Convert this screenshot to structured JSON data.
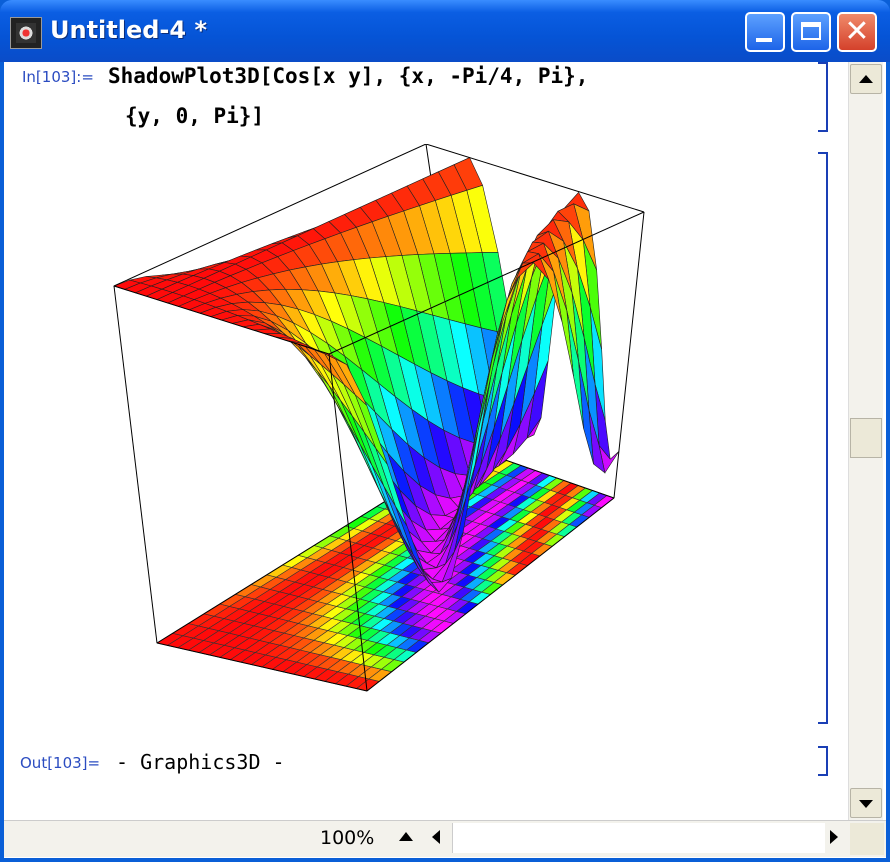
{
  "window": {
    "title": "Untitled-4 *"
  },
  "cell_in": {
    "label": "In[103]:=",
    "line1": "ShadowPlot3D[Cos[x y], {x, -Pi/4, Pi},",
    "line2": "{y, 0, Pi}]"
  },
  "cell_out": {
    "label": "Out[103]=",
    "text": "- Graphics3D -"
  },
  "statusbar": {
    "zoom": "100%"
  },
  "colors": {
    "titlebar": "#0a5fd7",
    "label_blue": "#2b4cc1",
    "bracket_blue": "#1a3fb5"
  },
  "plot": {
    "function": "Cos[x y]",
    "x_range": [
      "-Pi/4",
      "Pi"
    ],
    "y_range": [
      "0",
      "Pi"
    ],
    "coloring": "rainbow hue by height",
    "shadow": "floor projection"
  }
}
